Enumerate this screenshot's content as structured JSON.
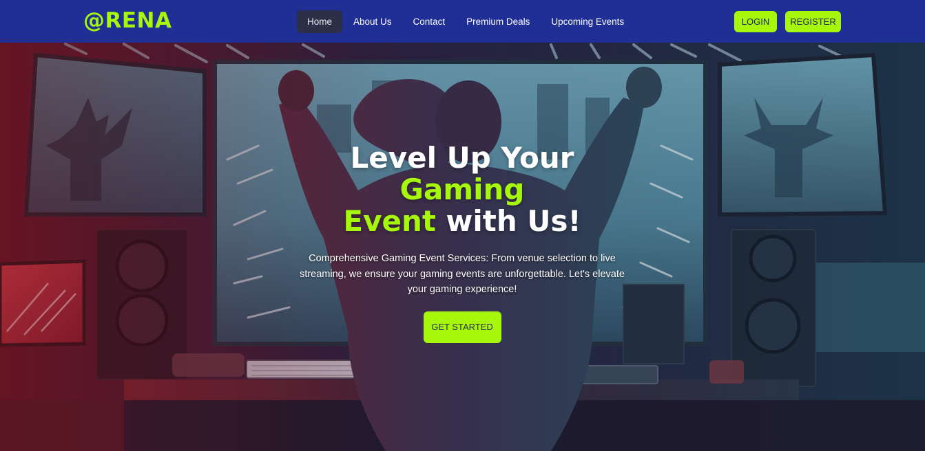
{
  "navbar": {
    "brand": "@RENA",
    "links": [
      {
        "label": "Home"
      },
      {
        "label": "About Us"
      },
      {
        "label": "Contact"
      },
      {
        "label": "Premium Deals"
      },
      {
        "label": "Upcoming Events"
      }
    ],
    "login_label": "LOGIN",
    "register_label": "REGISTER"
  },
  "hero": {
    "title_part1": "Level Up Your ",
    "title_highlight1": "Gaming",
    "title_highlight2": "Event",
    "title_part2": " with Us!",
    "description": "Comprehensive Gaming Event Services: From venue selection to live streaming, we ensure your gaming events are unforgettable. Let's elevate your gaming experience!",
    "cta_label": "GET STARTED"
  },
  "colors": {
    "navbar_bg": "#1f2f96",
    "accent": "#a6f70c",
    "active_link_bg": "#2b3048"
  }
}
